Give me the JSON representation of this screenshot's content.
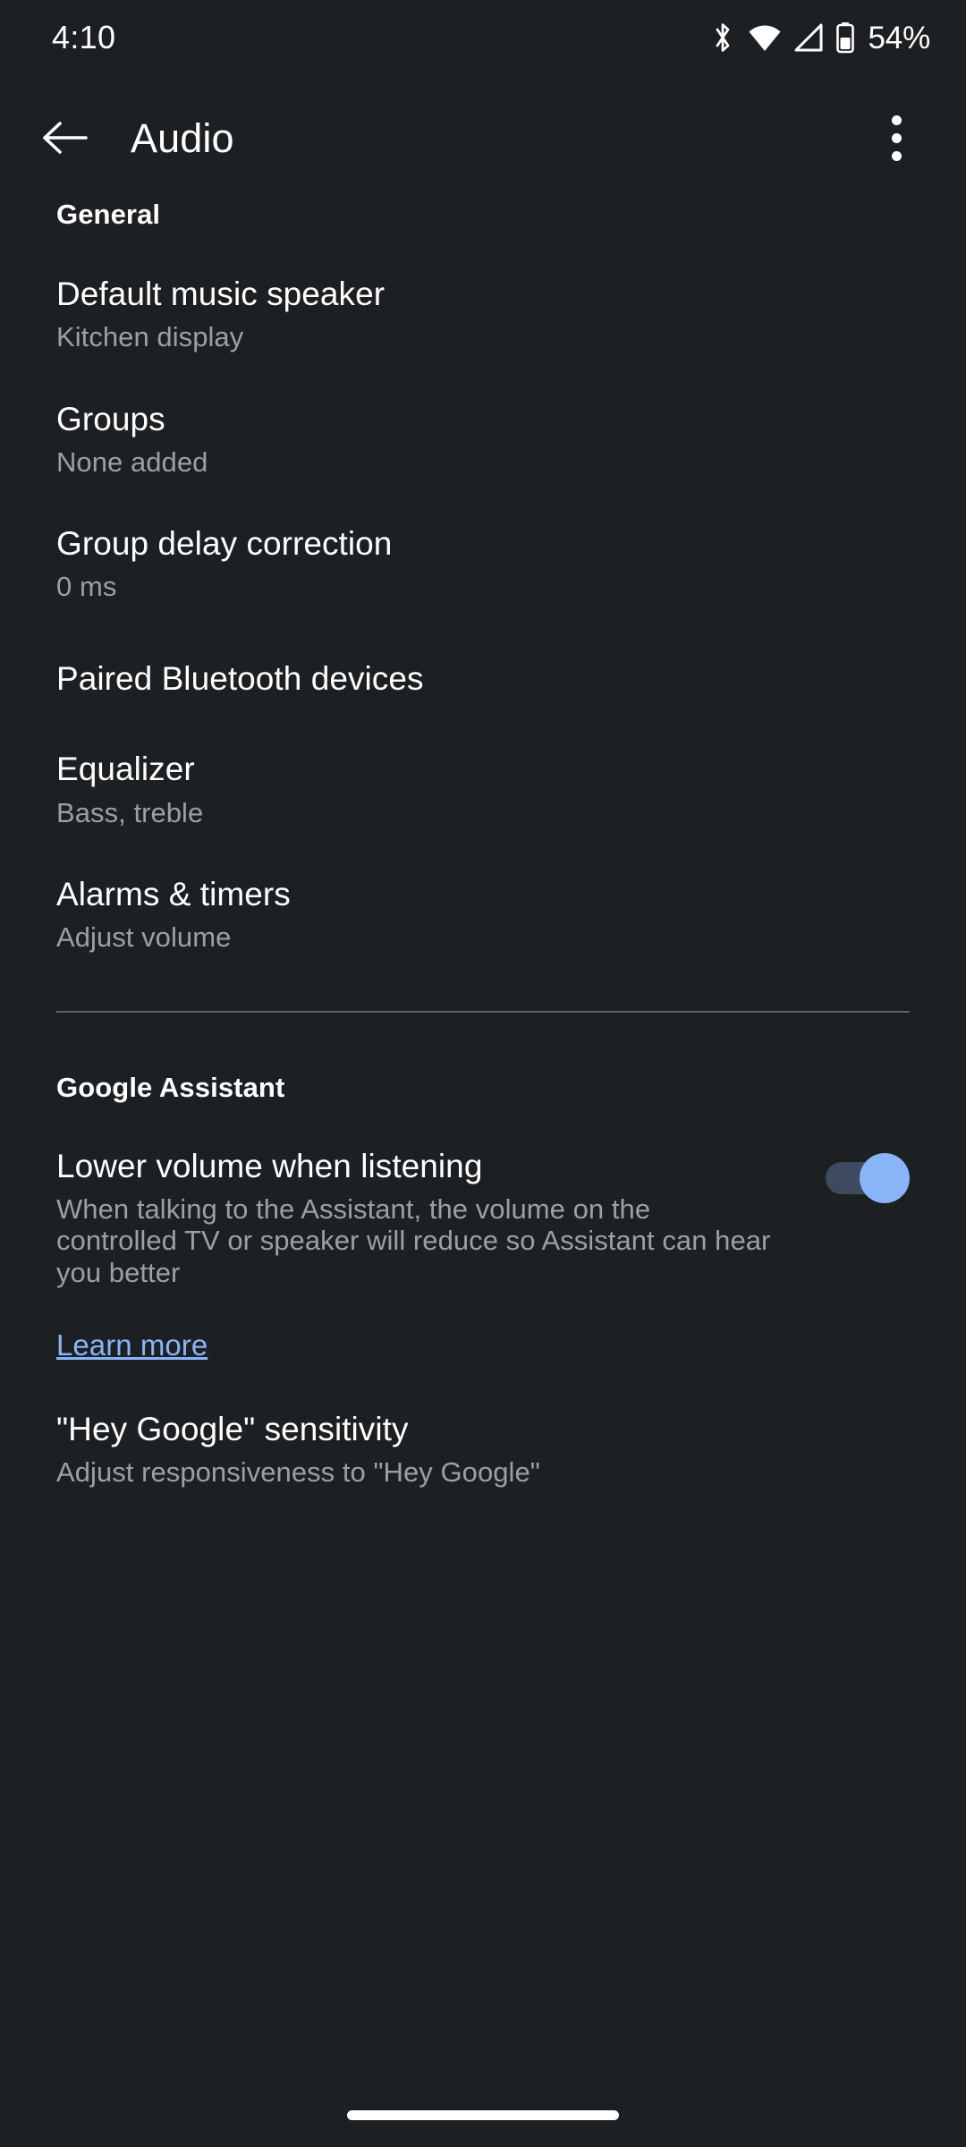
{
  "status_bar": {
    "time": "4:10",
    "battery_percent": "54%",
    "icons": [
      "bluetooth-icon",
      "wifi-icon",
      "cellular-signal-icon",
      "battery-icon"
    ]
  },
  "app_bar": {
    "back_label": "back-arrow-icon",
    "title": "Audio",
    "overflow_label": "more-options-icon"
  },
  "sections": [
    {
      "header": "General",
      "items": [
        {
          "title": "Default music speaker",
          "summary": "Kitchen display"
        },
        {
          "title": "Groups",
          "summary": "None added"
        },
        {
          "title": "Group delay correction",
          "summary": "0 ms"
        },
        {
          "title": "Paired Bluetooth devices",
          "summary": ""
        },
        {
          "title": "Equalizer",
          "summary": "Bass, treble"
        },
        {
          "title": "Alarms & timers",
          "summary": "Adjust volume"
        }
      ]
    },
    {
      "header": "Google Assistant",
      "items": [
        {
          "title": "Lower volume when listening",
          "summary": "When talking to the Assistant, the volume on the controlled TV or speaker will reduce so Assistant can hear you better",
          "toggle": true,
          "toggle_state": "on",
          "link": "Learn more"
        },
        {
          "title": "\"Hey Google\" sensitivity",
          "summary": "Adjust responsiveness to \"Hey Google\""
        }
      ]
    }
  ],
  "colors": {
    "background": "#1d2023",
    "primary_text": "#ffffff",
    "secondary_text": "#9aa0a6",
    "accent": "#8ab4f8",
    "switch_track": "#3f4a60",
    "divider": "#5f6368"
  },
  "nav_bar": {
    "home_indicator": "home-gesture-pill"
  }
}
